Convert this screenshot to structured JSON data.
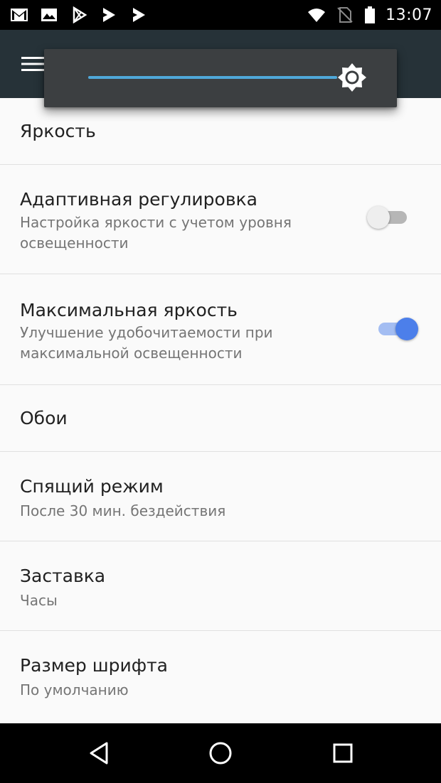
{
  "status_bar": {
    "time": "13:07",
    "left_icons": [
      "gmail-icon",
      "gallery-icon",
      "play-store-icon",
      "play-movies-icon",
      "play-movies-icon"
    ],
    "right_icons": [
      "wifi-icon",
      "no-sim-icon",
      "battery-icon"
    ]
  },
  "app_bar": {
    "menu_icon": "hamburger-menu-icon",
    "background": "#263238"
  },
  "brightness_popup": {
    "level": 1.0,
    "accent": "#4fa8d9",
    "icon": "brightness-icon"
  },
  "settings": {
    "brightness": {
      "title": "Яркость"
    },
    "adaptive": {
      "title": "Адаптивная регулировка",
      "subtitle": "Настройка яркости с учетом уровня освещенности",
      "enabled": false
    },
    "max_brightness": {
      "title": "Максимальная яркость",
      "subtitle": "Улучшение удобочитаемости при максимальной освещенности",
      "enabled": true
    },
    "wallpaper": {
      "title": "Обои"
    },
    "sleep": {
      "title": "Спящий режим",
      "subtitle": "После 30 мин. бездействия"
    },
    "screensaver": {
      "title": "Заставка",
      "subtitle": "Часы"
    },
    "font_size": {
      "title": "Размер шрифта",
      "subtitle": "По умолчанию"
    }
  },
  "colors": {
    "toggle_on": "#4c7fea",
    "toggle_off": "#eeeeee"
  },
  "nav_bar": {
    "buttons": [
      "back-icon",
      "home-icon",
      "recents-icon"
    ]
  }
}
